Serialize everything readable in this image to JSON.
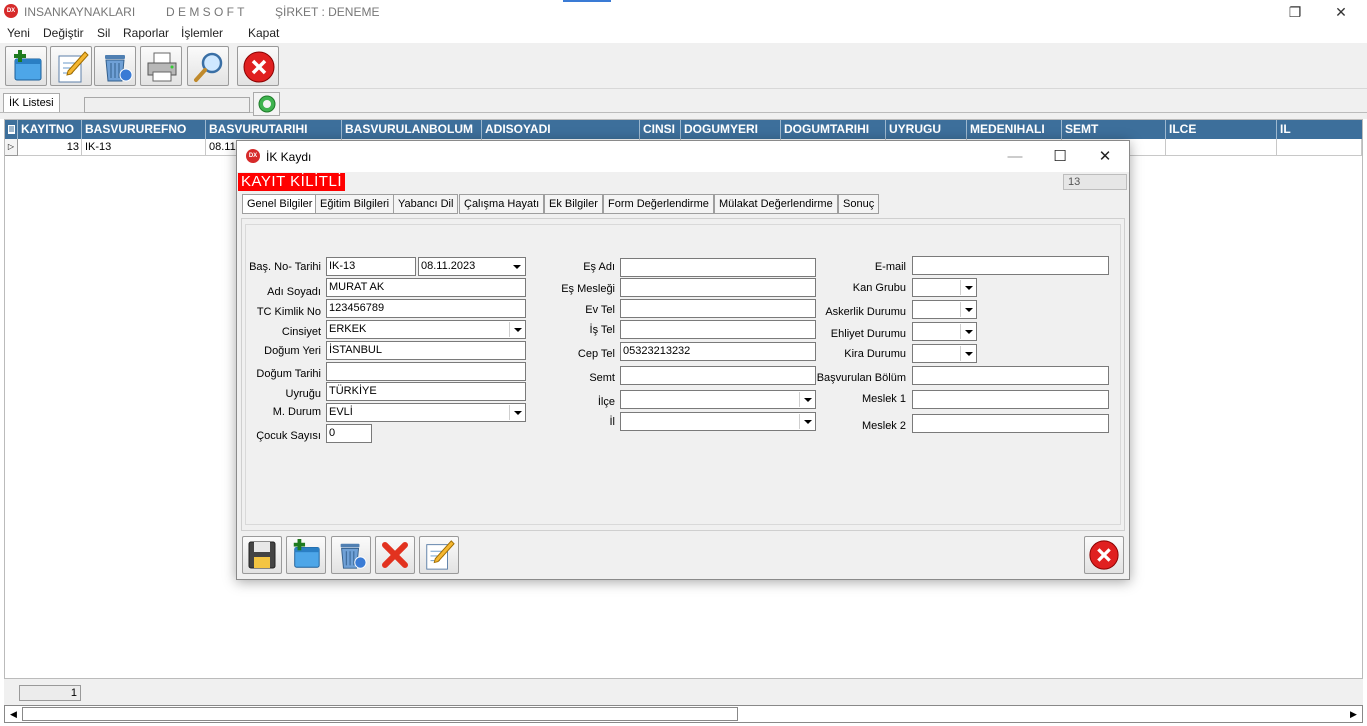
{
  "window": {
    "app_name": "INSANKAYNAKLARI",
    "company": "D E M S O F T",
    "firm": "ŞİRKET : DENEME",
    "restore_glyph": "❐",
    "close_glyph": "✕"
  },
  "menu": [
    "Yeni",
    "Değiştir",
    "Sil",
    "Raporlar",
    "İşlemler",
    "Kapat"
  ],
  "toolbar": {
    "icons": [
      "new-record-icon",
      "edit-icon",
      "delete-icon",
      "print-icon",
      "search-icon",
      "close-icon"
    ]
  },
  "list_tab": {
    "label": "İK Listesi"
  },
  "grid": {
    "columns": [
      "KAYITNO",
      "BASVURUREFNO",
      "BASVURUTARIHI",
      "BASVURULANBOLUM",
      "ADISOYADI",
      "CINSI",
      "DOGUMYERI",
      "DOGUMTARIHI",
      "UYRUGU",
      "MEDENIHALI",
      "SEMT",
      "ILCE",
      "IL"
    ],
    "rows": [
      [
        "13",
        "IK-13",
        "08.11.",
        "",
        "",
        "",
        "",
        "",
        "",
        "",
        "",
        "",
        ""
      ]
    ]
  },
  "status": {
    "record_count": "1"
  },
  "dialog": {
    "title": "İK Kaydı",
    "logo_text": "DX",
    "lock_banner": "KAYIT KİLİTLİ",
    "record_id": "13",
    "tabs": [
      "Genel Bilgiler",
      "Eğitim Bilgileri",
      "Yabancı Dil",
      "Çalışma Hayatı",
      "Ek Bilgiler",
      "Form Değerlendirme",
      "Mülakat Değerlendirme",
      "Sonuç"
    ],
    "left": {
      "bas_no_tarihi": {
        "label": "Baş. No- Tarihi",
        "no": "IK-13",
        "date": "08.11.2023"
      },
      "adi_soyadi": {
        "label": "Adı Soyadı",
        "value": "MURAT AK"
      },
      "tc_kimlik": {
        "label": "TC Kimlik No",
        "value": "123456789"
      },
      "cinsiyet": {
        "label": "Cinsiyet",
        "value": "ERKEK"
      },
      "dogum_yeri": {
        "label": "Doğum Yeri",
        "value": "İSTANBUL"
      },
      "dogum_tarihi": {
        "label": "Doğum Tarihi",
        "value": ""
      },
      "uyrugu": {
        "label": "Uyruğu",
        "value": "TÜRKİYE"
      },
      "m_durum": {
        "label": "M. Durum",
        "value": "EVLİ"
      },
      "cocuk_sayisi": {
        "label": "Çocuk Sayısı",
        "value": "0"
      }
    },
    "middle": {
      "es_adi": {
        "label": "Eş Adı",
        "value": ""
      },
      "es_meslegi": {
        "label": "Eş Mesleği",
        "value": ""
      },
      "ev_tel": {
        "label": "Ev Tel",
        "value": ""
      },
      "is_tel": {
        "label": "İş Tel",
        "value": ""
      },
      "cep_tel": {
        "label": "Cep Tel",
        "value": "05323213232"
      },
      "semt": {
        "label": "Semt",
        "value": ""
      },
      "ilce": {
        "label": "İlçe",
        "value": ""
      },
      "il": {
        "label": "İl",
        "value": ""
      }
    },
    "right": {
      "email": {
        "label": "E-mail",
        "value": ""
      },
      "kan_grubu": {
        "label": "Kan Grubu",
        "value": ""
      },
      "askerlik": {
        "label": "Askerlik Durumu",
        "value": ""
      },
      "ehliyet": {
        "label": "Ehliyet Durumu",
        "value": ""
      },
      "kira": {
        "label": "Kira Durumu",
        "value": ""
      },
      "basvurulan_bolum": {
        "label": "Başvurulan Bölüm",
        "value": ""
      },
      "meslek1": {
        "label": "Meslek 1",
        "value": ""
      },
      "meslek2": {
        "label": "Meslek 2",
        "value": ""
      }
    },
    "footer_icons": [
      "save-icon",
      "new-record-icon",
      "delete-icon",
      "cancel-icon",
      "edit-icon",
      "close-icon"
    ]
  },
  "colors": {
    "grid_header_bg": "#3d6f9b",
    "lock_banner_bg": "#ff0000",
    "close_red": "#e02020"
  }
}
